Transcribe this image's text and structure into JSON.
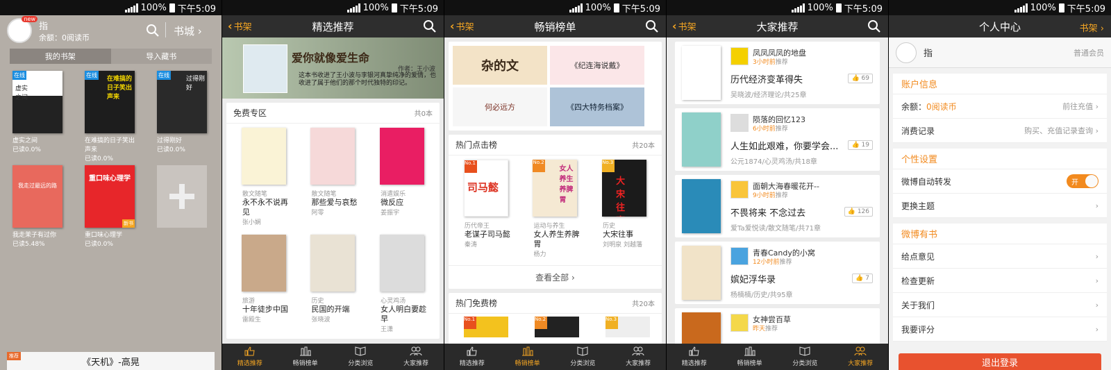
{
  "status": {
    "battery": "100%",
    "time": "下午5:09"
  },
  "s1": {
    "new_badge": "new",
    "user_name": "指",
    "balance": "余额：0阅读币",
    "store_label": "书城",
    "tab_shelf": "我的书架",
    "tab_import": "导入藏书",
    "books": [
      {
        "title": "虚实之间",
        "progress": "已读0.0%",
        "badge": "在线",
        "cover_text": "虚实之间"
      },
      {
        "title": "在难搞的日子笑出声来",
        "progress": "已读0.0%",
        "badge": "在线",
        "cover_text": "在难搞的日子笑出声来"
      },
      {
        "title": "过得刚好",
        "progress": "已读0.0%",
        "badge": "在线",
        "cover_text": "过得刚好"
      },
      {
        "title": "我走茉子有过你",
        "progress": "已读5.48%",
        "badge": "",
        "cover_text": "我走过最远的路"
      },
      {
        "title": "重口味心理学",
        "progress": "已读0.0%",
        "badge": "新书",
        "cover_text": "重口味心理学"
      }
    ],
    "bottom_tag": "推荐",
    "bottom_book": "《天机》-高晃"
  },
  "tabs": [
    "精选推荐",
    "畅销榜单",
    "分类浏览",
    "大家推荐"
  ],
  "s2": {
    "back": "书架",
    "title": "精选推荐",
    "banner_title": "爱你就像爱生命",
    "banner_author": "作者：王小波",
    "banner_desc": "这本书收进了王小波与李银河真挚纯净的爱情，也收进了属于他们的那个时代独特的印记。",
    "section": "免费专区",
    "count": "共0本",
    "books": [
      {
        "cat": "散文随笔",
        "title": "永不永不说再见",
        "author": "张小娴"
      },
      {
        "cat": "散文随笔",
        "title": "那些爱与哀愁",
        "author": "阿零"
      },
      {
        "cat": "消遣娱乐",
        "title": "微反应",
        "author": "姜振宇"
      },
      {
        "cat": "旅游",
        "title": "十年徒步中国",
        "author": "雷殿生"
      },
      {
        "cat": "历史",
        "title": "民国的开端",
        "author": "张晓波"
      },
      {
        "cat": "心灵鸡汤",
        "title": "女人明白要趁早",
        "author": "王潇"
      }
    ],
    "covers": [
      "永不永不说再见",
      "那些爱与哀愁",
      "微反应",
      "十年徒步中国",
      "民国的开端",
      "女人明白要趁早"
    ]
  },
  "s3": {
    "back": "书架",
    "title": "畅销榜单",
    "banners": [
      "杂的文",
      "《纪连海说戴》",
      "何必远方",
      "《四大特务档案》"
    ],
    "section": "热门点击榜",
    "count": "共20本",
    "books": [
      {
        "rank": "No.1",
        "cat": "历代帝王",
        "title": "老谋子司马懿",
        "author": "秦涛",
        "cover": "司马懿"
      },
      {
        "rank": "No.2",
        "cat": "运动与养生",
        "title": "女人养生养脾胃",
        "author": "杨力",
        "cover": "女人养生养脾胃"
      },
      {
        "rank": "No.3",
        "cat": "历史",
        "title": "大宋往事",
        "author": "刘明泉 刘越藩",
        "cover": "大宋往事"
      }
    ],
    "more": "查看全部",
    "section2": "热门免费榜",
    "count2": "共20本",
    "ranks2": [
      "No.1",
      "No.2",
      "No.3"
    ]
  },
  "s4": {
    "back": "书架",
    "title": "大家推荐",
    "items": [
      {
        "user": "凤凤凤凤的地盘",
        "time": "3小时前",
        "rec": "推荐",
        "title": "历代经济变革得失",
        "meta": "吴晓波/经济理论/共25章",
        "likes": "69"
      },
      {
        "user": "陨落的回忆123",
        "time": "6小时前",
        "rec": "推荐",
        "title": "人生如此艰难，你要学会...",
        "meta": "公元1874/心灵鸡汤/共18章",
        "likes": "19"
      },
      {
        "user": "面朝大海春暖花开--",
        "time": "9小时前",
        "rec": "推荐",
        "title": "不畏将来 不念过去",
        "meta": "爱Ta爱悦读/散文随笔/共71章",
        "likes": "126"
      },
      {
        "user": "青春Candy的小窝",
        "time": "12小时前",
        "rec": "推荐",
        "title": "嫔妃浮华录",
        "meta": "杨楠楠/历史/共95章",
        "likes": "7"
      },
      {
        "user": "女神尝百草",
        "time": "昨天",
        "rec": "推荐",
        "title": "",
        "meta": "",
        "likes": ""
      }
    ]
  },
  "s5": {
    "title": "个人中心",
    "right": "书架",
    "user_name": "指",
    "member": "普通会员",
    "acct_head": "账户信息",
    "balance_label": "余额：",
    "balance_val": "0阅读币",
    "recharge": "前往充值",
    "record": "消费记录",
    "record_r": "购买、充值记录查询",
    "pers_head": "个性设置",
    "weibo_fwd": "微博自动转发",
    "toggle": "开",
    "theme": "更换主题",
    "wb_head": "微博有书",
    "feedback": "给点意见",
    "update": "检查更新",
    "about": "关于我们",
    "rate": "我要评分",
    "logout": "退出登录"
  }
}
